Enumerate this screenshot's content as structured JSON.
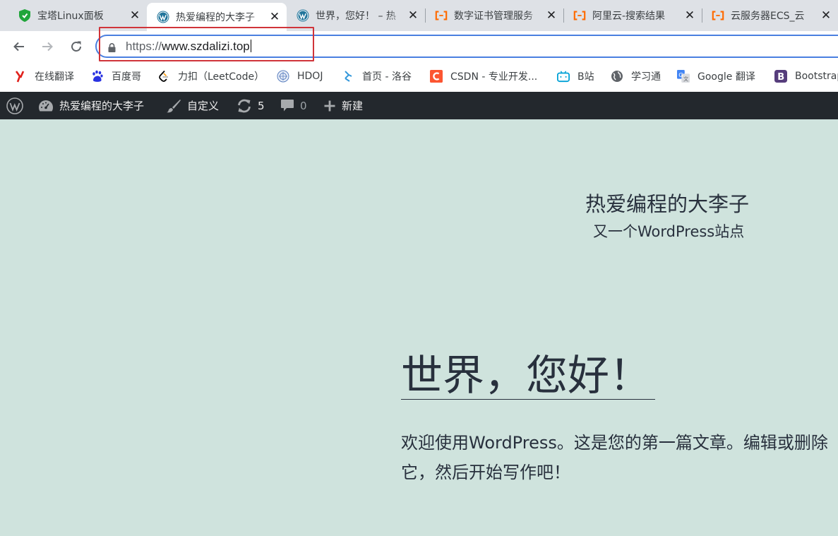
{
  "tabs": [
    {
      "title": "宝塔Linux面板",
      "icon": "bt-shield-icon",
      "active": false
    },
    {
      "title": "热爱编程的大李子",
      "icon": "wordpress-icon",
      "active": true
    },
    {
      "title": "世界，您好！ – 热",
      "icon": "wordpress-icon",
      "active": false
    },
    {
      "title": "数字证书管理服务",
      "icon": "aliyun-icon",
      "active": false
    },
    {
      "title": "阿里云-搜索结果",
      "icon": "aliyun-icon",
      "active": false
    },
    {
      "title": "云服务器ECS_云",
      "icon": "aliyun-icon",
      "active": false
    }
  ],
  "tab_close_glyph": "✕",
  "address_bar": {
    "scheme": "https://",
    "host": "www.szdalizi.top"
  },
  "bookmarks": [
    {
      "label": "在线翻译",
      "icon": "youdao-icon"
    },
    {
      "label": "百度哥",
      "icon": "baidu-paw-icon"
    },
    {
      "label": "力扣（LeetCode）",
      "icon": "leetcode-icon"
    },
    {
      "label": "HDOJ",
      "icon": "hdoj-icon"
    },
    {
      "label": "首页 - 洛谷",
      "icon": "luogu-icon"
    },
    {
      "label": "CSDN - 专业开发...",
      "icon": "csdn-icon"
    },
    {
      "label": "B站",
      "icon": "bilibili-icon"
    },
    {
      "label": "学习通",
      "icon": "globe-icon"
    },
    {
      "label": "Google 翻译",
      "icon": "google-translate-icon"
    },
    {
      "label": "Bootstrap",
      "icon": "bootstrap-icon"
    }
  ],
  "admin_bar": {
    "site_name": "热爱编程的大李子",
    "customize": "自定义",
    "updates_count": "5",
    "comments_count": "0",
    "new_label": "新建"
  },
  "site": {
    "title": "热爱编程的大李子",
    "description": "又一个WordPress站点"
  },
  "post": {
    "title": "世界，您好！",
    "body": "欢迎使用WordPress。这是您的第一篇文章。编辑或删除它，然后开始写作吧！"
  },
  "colors": {
    "page_background": "#cfe3dd",
    "admin_bar": "#23282d",
    "text": "#28303d",
    "omnibox_focus": "#4a7fe0",
    "highlight_box": "#d0343a"
  }
}
